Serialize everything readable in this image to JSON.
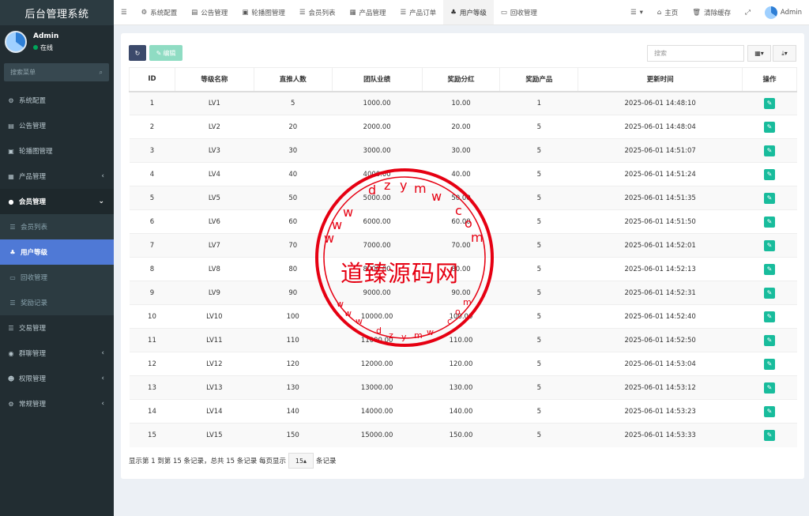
{
  "app": {
    "title": "后台管理系统"
  },
  "user": {
    "name": "Admin",
    "status": "在线"
  },
  "sidebar": {
    "search_placeholder": "搜索菜单",
    "items": [
      {
        "label": "系统配置",
        "icon": "gear-icon"
      },
      {
        "label": "公告管理",
        "icon": "file-icon"
      },
      {
        "label": "轮播图管理",
        "icon": "image-icon"
      },
      {
        "label": "产品管理",
        "icon": "grid-icon"
      },
      {
        "label": "会员管理",
        "icon": "user-icon"
      },
      {
        "label": "交易管理",
        "icon": "list-icon"
      },
      {
        "label": "群聊管理",
        "icon": "chat-icon"
      },
      {
        "label": "权限管理",
        "icon": "group-icon"
      },
      {
        "label": "常规管理",
        "icon": "cogs-icon"
      }
    ],
    "submenu": [
      {
        "label": "会员列表",
        "icon": "list-icon"
      },
      {
        "label": "用户等级",
        "icon": "sitemap-icon"
      },
      {
        "label": "回收管理",
        "icon": "card-icon"
      },
      {
        "label": "奖励记录",
        "icon": "list-icon"
      }
    ]
  },
  "topnav": {
    "tabs": [
      {
        "label": "系统配置",
        "icon": "gear-icon"
      },
      {
        "label": "公告管理",
        "icon": "file-icon"
      },
      {
        "label": "轮播图管理",
        "icon": "image-icon"
      },
      {
        "label": "会员列表",
        "icon": "list-icon"
      },
      {
        "label": "产品管理",
        "icon": "grid-icon"
      },
      {
        "label": "产品订单",
        "icon": "list-icon"
      },
      {
        "label": "用户等级",
        "icon": "sitemap-icon"
      },
      {
        "label": "回收管理",
        "icon": "card-icon"
      }
    ],
    "home": "主页",
    "clear_cache": "清除缓存",
    "admin": "Admin"
  },
  "toolbar": {
    "edit_label": "编辑",
    "search_placeholder": "搜索"
  },
  "table": {
    "headers": [
      "ID",
      "等级名称",
      "直推人数",
      "团队业绩",
      "奖励分红",
      "奖励产品",
      "更新时间",
      "操作"
    ],
    "rows": [
      [
        "1",
        "LV1",
        "5",
        "1000.00",
        "10.00",
        "1",
        "2025-06-01 14:48:10"
      ],
      [
        "2",
        "LV2",
        "20",
        "2000.00",
        "20.00",
        "5",
        "2025-06-01 14:48:04"
      ],
      [
        "3",
        "LV3",
        "30",
        "3000.00",
        "30.00",
        "5",
        "2025-06-01 14:51:07"
      ],
      [
        "4",
        "LV4",
        "40",
        "4000.00",
        "40.00",
        "5",
        "2025-06-01 14:51:24"
      ],
      [
        "5",
        "LV5",
        "50",
        "5000.00",
        "50.00",
        "5",
        "2025-06-01 14:51:35"
      ],
      [
        "6",
        "LV6",
        "60",
        "6000.00",
        "60.00",
        "5",
        "2025-06-01 14:51:50"
      ],
      [
        "7",
        "LV7",
        "70",
        "7000.00",
        "70.00",
        "5",
        "2025-06-01 14:52:01"
      ],
      [
        "8",
        "LV8",
        "80",
        "8000.00",
        "80.00",
        "5",
        "2025-06-01 14:52:13"
      ],
      [
        "9",
        "LV9",
        "90",
        "9000.00",
        "90.00",
        "5",
        "2025-06-01 14:52:31"
      ],
      [
        "10",
        "LV10",
        "100",
        "10000.00",
        "100.00",
        "5",
        "2025-06-01 14:52:40"
      ],
      [
        "11",
        "LV11",
        "110",
        "11000.00",
        "110.00",
        "5",
        "2025-06-01 14:52:50"
      ],
      [
        "12",
        "LV12",
        "120",
        "12000.00",
        "120.00",
        "5",
        "2025-06-01 14:53:04"
      ],
      [
        "13",
        "LV13",
        "130",
        "13000.00",
        "130.00",
        "5",
        "2025-06-01 14:53:12"
      ],
      [
        "14",
        "LV14",
        "140",
        "14000.00",
        "140.00",
        "5",
        "2025-06-01 14:53:23"
      ],
      [
        "15",
        "LV15",
        "150",
        "15000.00",
        "150.00",
        "5",
        "2025-06-01 14:53:33"
      ]
    ]
  },
  "pagination": {
    "summary": "显示第 1 到第 15 条记录，总共 15 条记录 每页显示",
    "page_size": "15",
    "suffix": "条记录"
  },
  "watermark": {
    "text": "道臻源码网",
    "url": "www.dzym.com"
  }
}
